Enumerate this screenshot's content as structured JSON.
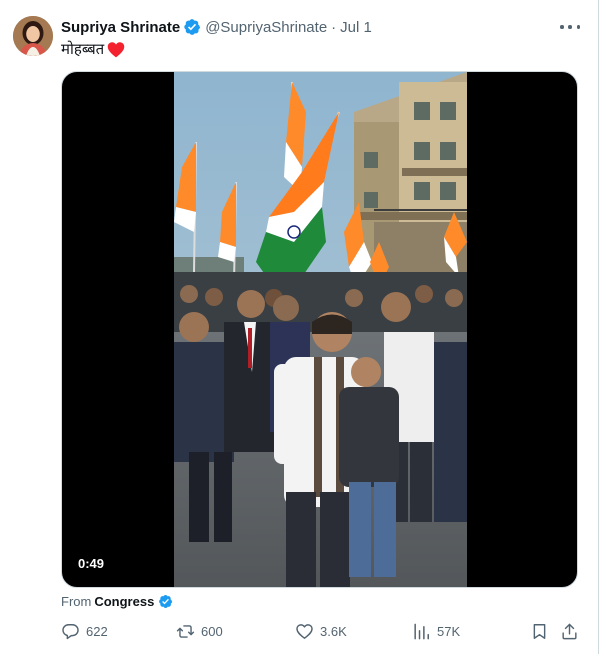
{
  "tweet": {
    "author_name": "Supriya Shrinate",
    "handle": "@SupriyaShrinate",
    "separator": "·",
    "date": "Jul 1",
    "text": "मोहब्बत",
    "text_emoji": "heart-emoji",
    "verified_color": "#1d9bf0"
  },
  "media": {
    "type": "video",
    "duration": "0:49"
  },
  "source": {
    "prefix": "From",
    "name": "Congress"
  },
  "actions": {
    "replies": "622",
    "retweets": "600",
    "likes": "3.6K",
    "views": "57K"
  },
  "colors": {
    "text_primary": "#0f1419",
    "text_secondary": "#536471",
    "border": "#cfd9de",
    "heart": "#f4212e"
  }
}
